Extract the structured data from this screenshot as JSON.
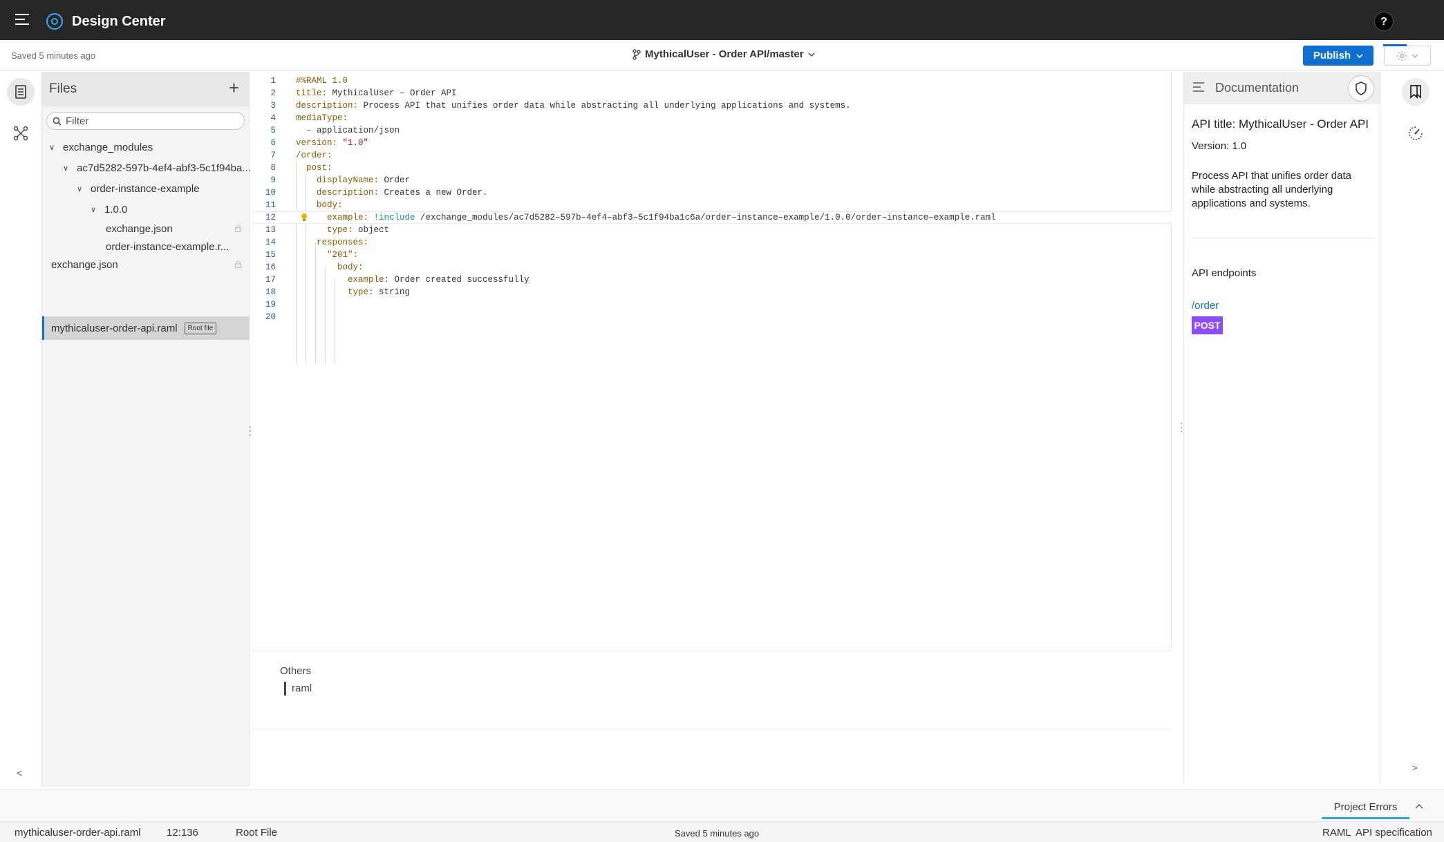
{
  "topbar": {
    "app_title": "Design Center",
    "help_label": "?"
  },
  "subheader": {
    "saved_text": "Saved 5 minutes ago",
    "branch": "MythicalUser - Order API/master",
    "publish_label": "Publish"
  },
  "files": {
    "title": "Files",
    "filter_placeholder": "Filter",
    "items": [
      {
        "label": "exchange_modules"
      },
      {
        "label": "ac7d5282-597b-4ef4-abf3-5c1f94ba..."
      },
      {
        "label": "order-instance-example"
      },
      {
        "label": "1.0.0"
      },
      {
        "label": "exchange.json"
      },
      {
        "label": "order-instance-example.r..."
      },
      {
        "label": "exchange.json"
      },
      {
        "label": "mythicaluser-order-api.raml",
        "badge": "Root file"
      }
    ]
  },
  "editor": {
    "line_numbers": [
      "1",
      "2",
      "3",
      "4",
      "5",
      "6",
      "7",
      "8",
      "9",
      "10",
      "11",
      "12",
      "13",
      "14",
      "15",
      "16",
      "17",
      "18",
      "19",
      "20"
    ],
    "lines": [
      {
        "key": "#%RAML 1.0",
        "val": ""
      },
      {
        "key": "title:",
        "val": " MythicalUser – Order API"
      },
      {
        "key": "description:",
        "val": " Process API that unifies order data while abstracting all underlying applications and systems."
      },
      {
        "key": "mediaType:",
        "val": ""
      },
      {
        "key": "  –",
        "val": " application/json"
      },
      {
        "key": "version:",
        "val": " \"1.0\""
      },
      {
        "key": "/order:",
        "val": ""
      },
      {
        "key": "  post:",
        "val": ""
      },
      {
        "key": "    displayName:",
        "val": " Order"
      },
      {
        "key": "    description:",
        "val": " Creates a new Order."
      },
      {
        "key": "    body:",
        "val": ""
      },
      {
        "key": "      example:",
        "val": " !include",
        "path": " /exchange_modules/ac7d5282–597b–4ef4–abf3–5c1f94ba1c6a/order–instance–example/1.0.0/order–instance–example.raml"
      },
      {
        "key": "      type:",
        "val": " object"
      },
      {
        "key": "    responses:",
        "val": ""
      },
      {
        "key": "      \"201\":",
        "val": ""
      },
      {
        "key": "        body:",
        "val": ""
      },
      {
        "key": "          example:",
        "val": " Order created successfully"
      },
      {
        "key": "          type:",
        "val": " string"
      },
      {
        "key": "",
        "val": ""
      },
      {
        "key": "",
        "val": ""
      }
    ]
  },
  "others": {
    "title": "Others",
    "item": "raml"
  },
  "documentation": {
    "title": "Documentation",
    "api_title": "API title: MythicalUser - Order API",
    "version": "Version: 1.0",
    "description": "Process API that unifies order data while abstracting all underlying applications and systems.",
    "endpoints_label": "API endpoints",
    "endpoint": "/order",
    "method": "POST"
  },
  "project_errors": {
    "label": "Project Errors"
  },
  "statusbar": {
    "file": "mythicaluser-order-api.raml",
    "cursor": "12:136",
    "file_type": "Root File",
    "saved": "Saved 5 minutes ago",
    "language": "RAML",
    "mode": "API specification"
  },
  "colors": {
    "accent": "#0f6ed1",
    "post_badge": "#8c4cf7",
    "topbar": "#262626"
  },
  "icons": [
    "menu-icon",
    "design-center-logo-icon",
    "branch-icon",
    "chevron-down-icon",
    "gear-icon",
    "files-icon",
    "graph-icon",
    "plus-icon",
    "search-icon",
    "lock-icon",
    "lightbulb-icon",
    "list-icon",
    "shield-icon",
    "bookmarks-icon",
    "speedometer-icon",
    "chevron-up-icon"
  ]
}
